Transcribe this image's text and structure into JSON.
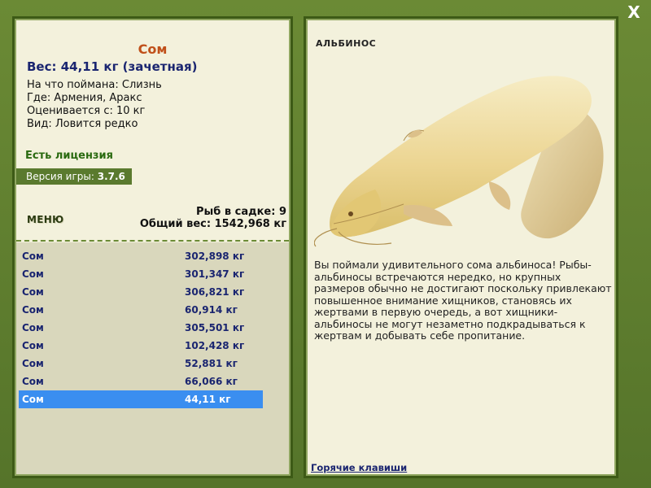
{
  "window": {
    "close_label": "X"
  },
  "fish": {
    "title": "Сом",
    "weight_line": "Вес: 44,11 кг (зачетная)",
    "caught_on": "На что поймана: Слизнь",
    "location": "Где: Армения, Аракс",
    "rated_from": "Оценивается с: 10 кг",
    "kind": "Вид: Ловится редко"
  },
  "license": "Есть лицензия",
  "version": {
    "label": "Версия игры:",
    "value": "3.7.6"
  },
  "menu_label": "МЕНЮ",
  "cage": {
    "count_line": "Рыб в садке: 9",
    "total_line": "Общий вес: 1542,968 кг"
  },
  "catches": [
    {
      "name": "Сом",
      "weight": "302,898 кг"
    },
    {
      "name": "Сом",
      "weight": "301,347 кг"
    },
    {
      "name": "Сом",
      "weight": "306,821 кг"
    },
    {
      "name": "Сом",
      "weight": "60,914 кг"
    },
    {
      "name": "Сом",
      "weight": "305,501 кг"
    },
    {
      "name": "Сом",
      "weight": "102,428 кг"
    },
    {
      "name": "Сом",
      "weight": "52,881 кг"
    },
    {
      "name": "Сом",
      "weight": "66,066 кг"
    },
    {
      "name": "Сом",
      "weight": "44,11 кг",
      "selected": true
    }
  ],
  "detail": {
    "albino_title": "АЛЬБИНОС",
    "description": "Вы поймали удивительного сома альбиноса! Рыбы-альбиносы встречаются нередко, но крупных размеров обычно не достигают поскольку привлекают повышенное внимание хищников, становясь их жертвами в первую очередь, а вот хищники-альбиносы не могут незаметно подкрадываться к жертвам и добывать себе пропитание.",
    "hotkeys_link": "Горячие клавиши"
  },
  "colors": {
    "frame": "#5c7a2a",
    "panel": "#f3f1dc",
    "selected_row": "#3a8ef0",
    "title": "#c0501a",
    "text_blue": "#1a2570"
  },
  "icons": {
    "close": "close-icon",
    "fish": "catfish-albino-image"
  }
}
